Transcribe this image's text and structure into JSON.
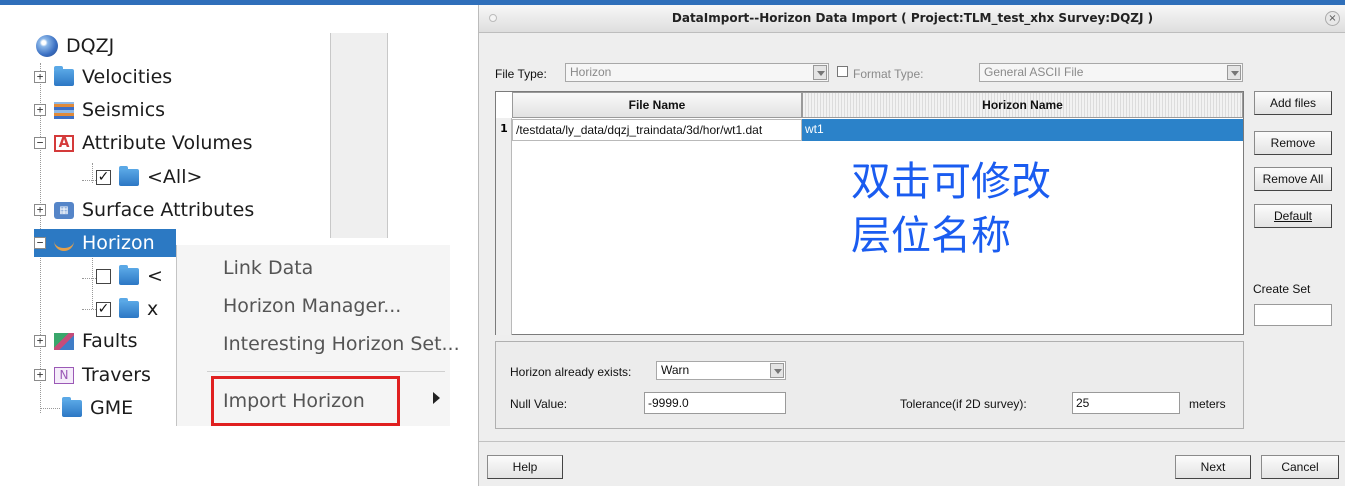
{
  "tree": {
    "root": "DQZJ",
    "items": [
      {
        "label": "Velocities"
      },
      {
        "label": "Seismics"
      },
      {
        "label": "Attribute Volumes"
      },
      {
        "label": "<All>"
      },
      {
        "label": "Surface Attributes"
      },
      {
        "label": "Horizon"
      },
      {
        "label": "<"
      },
      {
        "label": "x"
      },
      {
        "label": "Faults"
      },
      {
        "label": "Travers"
      },
      {
        "label": "GME"
      }
    ]
  },
  "context_menu": {
    "items": [
      "Link Data",
      "Horizon Manager...",
      "Interesting Horizon Set...",
      "Import Horizon"
    ]
  },
  "dialog": {
    "title": "DataImport--Horizon Data Import ( Project:TLM_test_xhx  Survey:DQZJ )",
    "close_glyph": "×",
    "file_type_label": "File Type:",
    "file_type_value": "Horizon",
    "format_type_label": "Format Type:",
    "format_type_value": "General ASCII File",
    "table": {
      "columns": [
        "File Name",
        "Horizon Name"
      ],
      "rows": [
        {
          "num": "1",
          "file": "/testdata/ly_data/dqzj_traindata/3d/hor/wt1.dat",
          "horizon": "wt1"
        }
      ]
    },
    "annotation": "双击可修改\n层位名称",
    "side_buttons": {
      "add": "Add files",
      "remove": "Remove",
      "remove_all": "Remove All",
      "default": "Default"
    },
    "create_set_label": "Create Set",
    "create_set_value": "",
    "exists_label": "Horizon already exists:",
    "exists_value": "Warn",
    "null_label": "Null Value:",
    "null_value": "-9999.0",
    "tolerance_label": "Tolerance(if 2D survey):",
    "tolerance_value": "25",
    "tolerance_unit": "meters",
    "help": "Help",
    "next": "Next",
    "cancel": "Cancel"
  },
  "colors": {
    "highlight": "#2b82c9",
    "annotation": "#1a5cf0",
    "menu_box": "#e02020"
  }
}
